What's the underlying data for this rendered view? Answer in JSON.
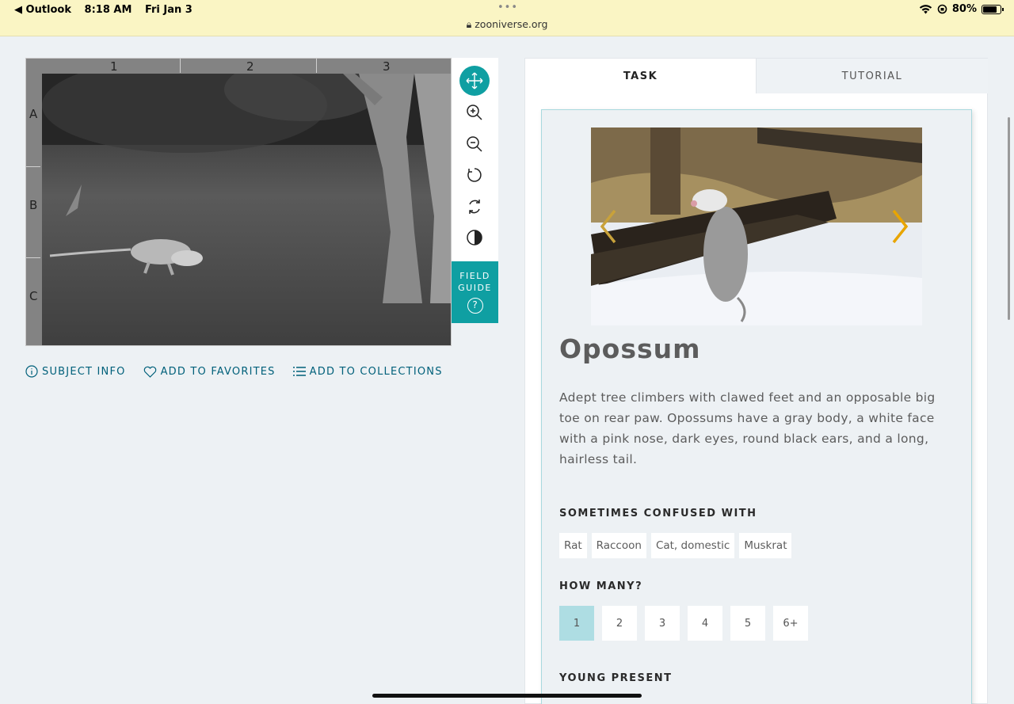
{
  "statusbar": {
    "back_app": "◀ Outlook",
    "time": "8:18 AM",
    "date": "Fri Jan 3",
    "dots": "•••",
    "url": "zooniverse.org",
    "battery": "80%"
  },
  "viewer": {
    "columns": [
      "1",
      "2",
      "3"
    ],
    "rows": [
      "A",
      "B",
      "C"
    ],
    "tools": [
      "move-icon",
      "zoom-in-icon",
      "zoom-out-icon",
      "rotate-icon",
      "reset-icon",
      "invert-icon"
    ]
  },
  "field_guide": {
    "line1": "FIELD",
    "line2": "GUIDE",
    "icon": "?"
  },
  "meta": {
    "subject_info": "SUBJECT INFO",
    "favorites": "ADD TO FAVORITES",
    "collections": "ADD TO COLLECTIONS"
  },
  "tabs": {
    "task": "TASK",
    "tutorial": "TUTORIAL"
  },
  "species": {
    "name": "Opossum",
    "description": "Adept tree climbers with clawed feet and an opposable big toe on rear paw. Opossums have a gray body, a white face with a pink nose, dark eyes, round black ears, and a long, hairless tail."
  },
  "confused": {
    "heading": "SOMETIMES CONFUSED WITH",
    "items": [
      "Rat",
      "Raccoon",
      "Cat, domestic",
      "Muskrat"
    ]
  },
  "how_many": {
    "heading": "HOW MANY?",
    "options": [
      "1",
      "2",
      "3",
      "4",
      "5",
      "6+"
    ],
    "selected": "1"
  },
  "young": {
    "heading": "YOUNG PRESENT"
  },
  "colors": {
    "teal": "#0f9fa2",
    "link": "#00607a",
    "selected": "#aedde3",
    "arrow": "#e8a500"
  }
}
